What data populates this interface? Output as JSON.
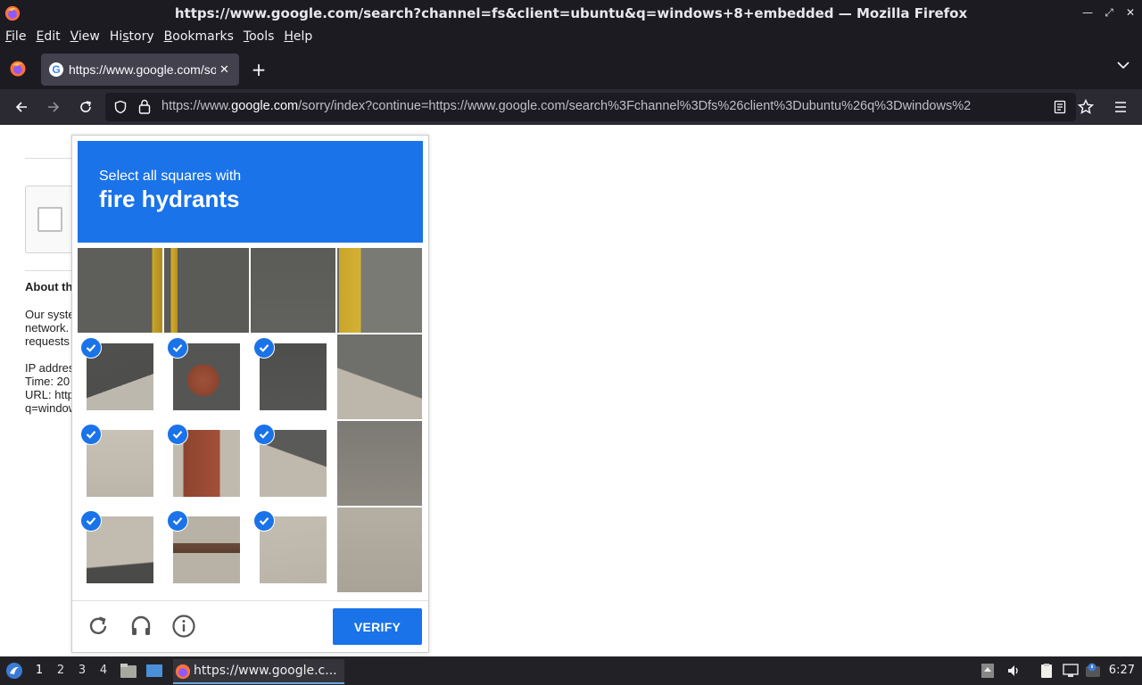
{
  "window": {
    "title": "https://www.google.com/search?channel=fs&client=ubuntu&q=windows+8+embedded — Mozilla Firefox"
  },
  "menu": {
    "items": [
      "File",
      "Edit",
      "View",
      "History",
      "Bookmarks",
      "Tools",
      "Help"
    ],
    "mnemonics": [
      "F",
      "E",
      "V",
      "s",
      "B",
      "T",
      "H"
    ]
  },
  "tabs": [
    {
      "title": "https://www.google.com/sorry/index",
      "active": true
    }
  ],
  "navbar": {
    "url_prefix": "https://www.",
    "url_domain": "google.com",
    "url_rest": "/sorry/index?continue=https://www.google.com/search%3Fchannel%3Dfs%26client%3Dubuntu%26q%3Dwindows%2"
  },
  "page": {
    "about_heading": "About th",
    "para1": [
      "Our syste",
      "network.",
      "requests"
    ],
    "para2": [
      "IP addres",
      "Time: 20",
      "URL: http",
      "q=window"
    ]
  },
  "captcha": {
    "instruction": "Select all squares with",
    "target": "fire hydrants",
    "verify_label": "VERIFY",
    "header_color": "#1a73e8",
    "grid_size": 4,
    "selected_cells": [
      4,
      5,
      6,
      8,
      9,
      10,
      12,
      13,
      14
    ]
  },
  "taskbar": {
    "workspaces": [
      "1",
      "2",
      "3",
      "4"
    ],
    "active_workspace": "1",
    "window_label": "https://www.google.c...",
    "clock": "6:27"
  }
}
